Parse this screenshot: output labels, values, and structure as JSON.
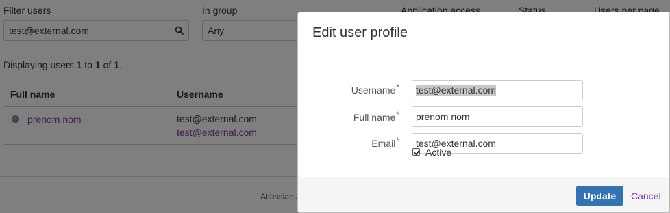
{
  "filters": {
    "filter_users_label": "Filter users",
    "filter_users_value": "test@external.com",
    "in_group_label": "In group",
    "in_group_value": "Any",
    "application_access_label": "Application access",
    "status_label": "Status",
    "users_per_page_label": "Users per page"
  },
  "summary": {
    "prefix": "Displaying users",
    "from": "1",
    "to_word": "to",
    "to": "1",
    "of_word": "of",
    "total": "1",
    "end": "."
  },
  "table": {
    "headers": {
      "full_name": "Full name",
      "username": "Username"
    },
    "rows": [
      {
        "full_name": "prenom nom",
        "username": "test@external.com",
        "email": "test@external.com"
      }
    ]
  },
  "footer": {
    "text": "Atlassian J"
  },
  "modal": {
    "title": "Edit user profile",
    "fields": {
      "username_label": "Username",
      "username_value": "test@external.com",
      "full_name_label": "Full name",
      "full_name_value": "prenom nom",
      "email_label": "Email",
      "email_value": "test@external.com",
      "required_mark": "*"
    },
    "active_label": "Active",
    "active_checked": true,
    "update_label": "Update",
    "cancel_label": "Cancel"
  },
  "colors": {
    "primary_button": "#3572b0",
    "link": "#7b3aa6",
    "required": "#d04437"
  }
}
